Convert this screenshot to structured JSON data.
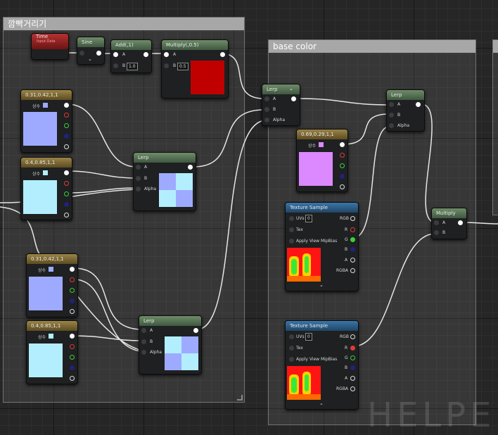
{
  "comments": {
    "blink": "깜빡거리기",
    "base_color": "base color"
  },
  "nodes": {
    "time": {
      "title": "Time",
      "subtitle": "Input Data"
    },
    "sine": {
      "title": "Sine"
    },
    "add": {
      "title": "Add(,1)",
      "pin_a": "A",
      "pin_b": "B",
      "b_value": "1.0"
    },
    "mul_top": {
      "title": "Multiply(,0.5)",
      "pin_a": "A",
      "pin_b": "B",
      "b_value": "0.5",
      "swatch": "#c00000"
    },
    "const1": {
      "title": "0.31,0.42,1,1",
      "label": "상수",
      "color": "#9eaaff"
    },
    "const2": {
      "title": "0.4,0.85,1,1",
      "label": "상수",
      "color": "#b3eeff"
    },
    "const3": {
      "title": "0.31,0.42,1,1",
      "label": "상수",
      "color": "#9eaaff"
    },
    "const4": {
      "title": "0.4,0.85,1,1",
      "label": "상수",
      "color": "#b3eeff"
    },
    "const5": {
      "title": "0.69,0.29,1,1",
      "label": "상수",
      "color": "#dc88ff"
    },
    "lerp1": {
      "title": "Lerp",
      "pin_a": "A",
      "pin_b": "B",
      "pin_alpha": "Alpha"
    },
    "lerp2": {
      "title": "Lerp",
      "pin_a": "A",
      "pin_b": "B",
      "pin_alpha": "Alpha"
    },
    "lerp3": {
      "title": "Lerp",
      "pin_a": "A",
      "pin_b": "B",
      "pin_alpha": "Alpha"
    },
    "lerp4": {
      "title": "Lerp",
      "pin_a": "A",
      "pin_b": "B",
      "pin_alpha": "Alpha"
    },
    "tex1": {
      "title": "Texture Sample",
      "uvs": "UVs",
      "uvs_value": "0",
      "tex": "Tex",
      "mip": "Apply View MipBias",
      "out_rgb": "RGB",
      "out_r": "R",
      "out_g": "G",
      "out_b": "B",
      "out_a": "A",
      "out_rgba": "RGBA"
    },
    "tex2": {
      "title": "Texture Sample",
      "uvs": "UVs",
      "uvs_value": "0",
      "tex": "Tex",
      "mip": "Apply View MipBias",
      "out_rgb": "RGB",
      "out_r": "R",
      "out_g": "G",
      "out_b": "B",
      "out_a": "A",
      "out_rgba": "RGBA"
    },
    "mul_right": {
      "title": "Multiply",
      "pin_a": "A",
      "pin_b": "B"
    }
  },
  "watermark": "HELPE",
  "colors": {
    "wire": "#e6e6e6",
    "checker_light": "#b3eeff",
    "checker_dark": "#9eaaff",
    "red_pin": "#e03a3a",
    "green_pin": "#3ccf3c",
    "blue_pin": "#22227a"
  },
  "icons": [
    "output-pin",
    "input-pin",
    "collapse-chevron",
    "resize-grip"
  ]
}
